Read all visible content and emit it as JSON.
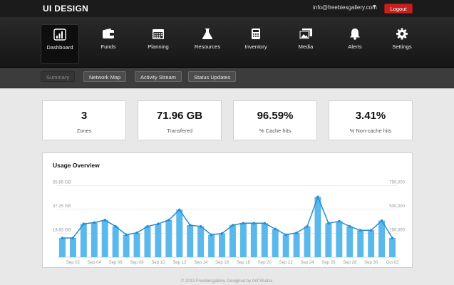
{
  "header": {
    "brand": "UI DESIGN",
    "user_email": "info@freebiesgallery.com",
    "caret": "▼",
    "logout_label": "Logout"
  },
  "nav": {
    "items": [
      {
        "label": "Dashboard",
        "icon": "chart-icon",
        "active": true
      },
      {
        "label": "Funds",
        "icon": "wallet-icon"
      },
      {
        "label": "Planning",
        "icon": "calendar-icon"
      },
      {
        "label": "Resources",
        "icon": "flask-icon"
      },
      {
        "label": "Inventory",
        "icon": "calculator-icon"
      },
      {
        "label": "Media",
        "icon": "photos-icon"
      },
      {
        "label": "Alerts",
        "icon": "bell-icon"
      },
      {
        "label": "Settings",
        "icon": "gear-icon"
      }
    ]
  },
  "subnav": {
    "tabs": [
      {
        "label": "Summary",
        "active": true
      },
      {
        "label": "Network Map"
      },
      {
        "label": "Activity Stream"
      },
      {
        "label": "Status Updates"
      }
    ]
  },
  "stats": [
    {
      "value": "3",
      "label": "Zones"
    },
    {
      "value": "71.96 GB",
      "label": "Transfered"
    },
    {
      "value": "96.59%",
      "label": "% Cache hits"
    },
    {
      "value": "3.41%",
      "label": "% Non-cache hits"
    }
  ],
  "usage": {
    "title": "Usage Overview"
  },
  "chart_data": {
    "type": "bar",
    "title": "Usage Overview",
    "categories": [
      "Sep 01",
      "Sep 02",
      "Sep 03",
      "Sep 04",
      "Sep 05",
      "Sep 06",
      "Sep 07",
      "Sep 08",
      "Sep 09",
      "Sep 10",
      "Sep 11",
      "Sep 12",
      "Sep 13",
      "Sep 14",
      "Sep 15",
      "Sep 16",
      "Sep 17",
      "Sep 18",
      "Sep 19",
      "Sep 20",
      "Sep 21",
      "Sep 22",
      "Sep 23",
      "Sep 24",
      "Sep 25",
      "Sep 26",
      "Sep 27",
      "Sep 28",
      "Sep 29",
      "Sep 30",
      "Oct 01",
      "Oct 02"
    ],
    "x_tick_labels": [
      "Sep 02",
      "Sep 04",
      "Sep 06",
      "Sep 08",
      "Sep 10",
      "Sep 12",
      "Sep 14",
      "Sep 16",
      "Sep 18",
      "Sep 20",
      "Sep 22",
      "Sep 24",
      "Sep 26",
      "Sep 28",
      "Sep 30",
      "Oct 02"
    ],
    "series": [
      {
        "values": [
          15.0,
          15.0,
          26.0,
          27.0,
          29.0,
          24.0,
          17.5,
          19.0,
          24.0,
          26.0,
          29.0,
          37.0,
          25.0,
          24.0,
          17.5,
          18.5,
          25.0,
          26.5,
          26.5,
          26.5,
          22.0,
          17.5,
          19.0,
          24.0,
          47.0,
          26.5,
          28.0,
          24.0,
          21.0,
          21.0,
          28.5,
          15.0
        ],
        "axis": "left",
        "style": "bars",
        "color": "#5bb8ea"
      },
      {
        "values": [
          15.0,
          15.0,
          26.0,
          27.0,
          29.0,
          24.0,
          17.5,
          19.0,
          24.0,
          26.0,
          29.0,
          37.0,
          25.0,
          24.0,
          17.5,
          18.5,
          25.0,
          26.5,
          26.5,
          26.5,
          22.0,
          17.5,
          19.0,
          24.0,
          47.0,
          26.5,
          28.0,
          24.0,
          21.0,
          21.0,
          28.5,
          15.0
        ],
        "axis": "left",
        "style": "line",
        "color": "#2a8bd0"
      }
    ],
    "y_left": {
      "ticks": [
        "55.88 GB",
        "37.25 GB",
        "18.63 GB"
      ],
      "tick_values": [
        55.88,
        37.25,
        18.63
      ],
      "range": [
        0,
        60
      ]
    },
    "y_right": {
      "ticks": [
        "750,000",
        "500,000",
        "250,000"
      ],
      "tick_values": [
        750000,
        500000,
        250000
      ],
      "range": [
        0,
        805346
      ]
    },
    "grid": true
  },
  "footer": {
    "text": "© 2013 Freebiesgallery. Designed by Arif Shaha."
  }
}
